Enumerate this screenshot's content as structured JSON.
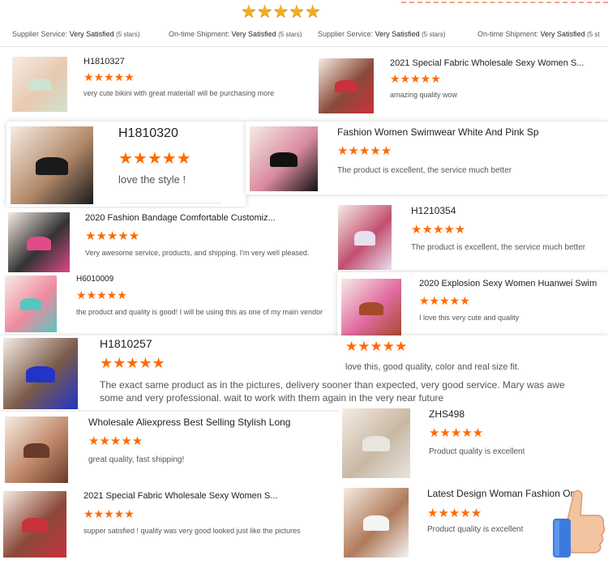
{
  "header": {
    "gold_stars": "★★★★★",
    "meta_left": {
      "label": "Supplier Service:",
      "value": "Very Satisfied",
      "count": "(5 stars)"
    },
    "meta_left2": {
      "label": "On-time Shipment:",
      "value": "Very Satisfied",
      "count": "(5 stars)"
    },
    "meta_right": {
      "label": "Supplier Service:",
      "value": "Very Satisfied",
      "count": "(5 stars)"
    },
    "meta_right2": {
      "label": "On-time Shipment:",
      "value": "Very Satisfied",
      "count": "(5 st"
    }
  },
  "stars": "★★★★★",
  "reviews": [
    {
      "title": "H1810327",
      "text": "very cute bikini with great material! will be purchasing more",
      "colors": [
        "#cfe3d0",
        "#e8c9b0"
      ]
    },
    {
      "title": "2021 Special Fabric Wholesale Sexy Women S...",
      "text": "amazing quality wow",
      "colors": [
        "#c8323c",
        "#8a4a3a"
      ]
    },
    {
      "title": "H1810320",
      "text": "love the style !",
      "colors": [
        "#1a1a1a",
        "#b48a6a"
      ]
    },
    {
      "title": "Fashion Women Swimwear White And Pink Sp",
      "text": "The product is excellent, the service much better",
      "colors": [
        "#111111",
        "#d98aa0"
      ]
    },
    {
      "title": "2020 Fashion Bandage Comfortable Customiz...",
      "text": "Very awesome service, products, and shipping. I'm very well pleased.",
      "colors": [
        "#e24a8a",
        "#333333"
      ]
    },
    {
      "title": "H1210354",
      "text": "The product is excellent, the service much better",
      "colors": [
        "#e8e0ee",
        "#c25070"
      ]
    },
    {
      "title": "H6010009",
      "text": "the product and quality is good! I will be using this as one of my main vendor",
      "colors": [
        "#57c6c0",
        "#f08aa0"
      ]
    },
    {
      "title": "2020 Explosion Sexy Women Huanwei Swim",
      "text": "I love this very cute and quality",
      "colors": [
        "#a54a2a",
        "#e06aa0"
      ]
    },
    {
      "title": "H1810257",
      "text": "The exact same product as in the pictures, delivery sooner than expected, very good service. Mary was awe",
      "text2": "some and very professional. wait to work with them again in the very near future",
      "colors": [
        "#2233c8",
        "#7a5a4a"
      ]
    },
    {
      "title": "",
      "text": "love this, good quality, color and real size fit.",
      "colors": []
    },
    {
      "title": "Wholesale Aliexpress Best Selling Stylish Long",
      "text": "great quality, fast shipping!",
      "colors": [
        "#6a3a2a",
        "#c08a6a"
      ]
    },
    {
      "title": "ZHS498",
      "text": "Product quality is excellent",
      "colors": [
        "#e8e4de",
        "#c8b8a4"
      ]
    },
    {
      "title": "2021 Special Fabric Wholesale Sexy Women S...",
      "text": "supper satisfied ! quality was very good looked just like the pictures",
      "colors": [
        "#c8323c",
        "#8a4a3a"
      ]
    },
    {
      "title": "Latest Design Woman Fashion On",
      "text": "Product quality is excellent",
      "colors": [
        "#f4f4f4",
        "#b07a5a"
      ]
    }
  ],
  "thumbs_up_icon": "thumbs-up-icon"
}
